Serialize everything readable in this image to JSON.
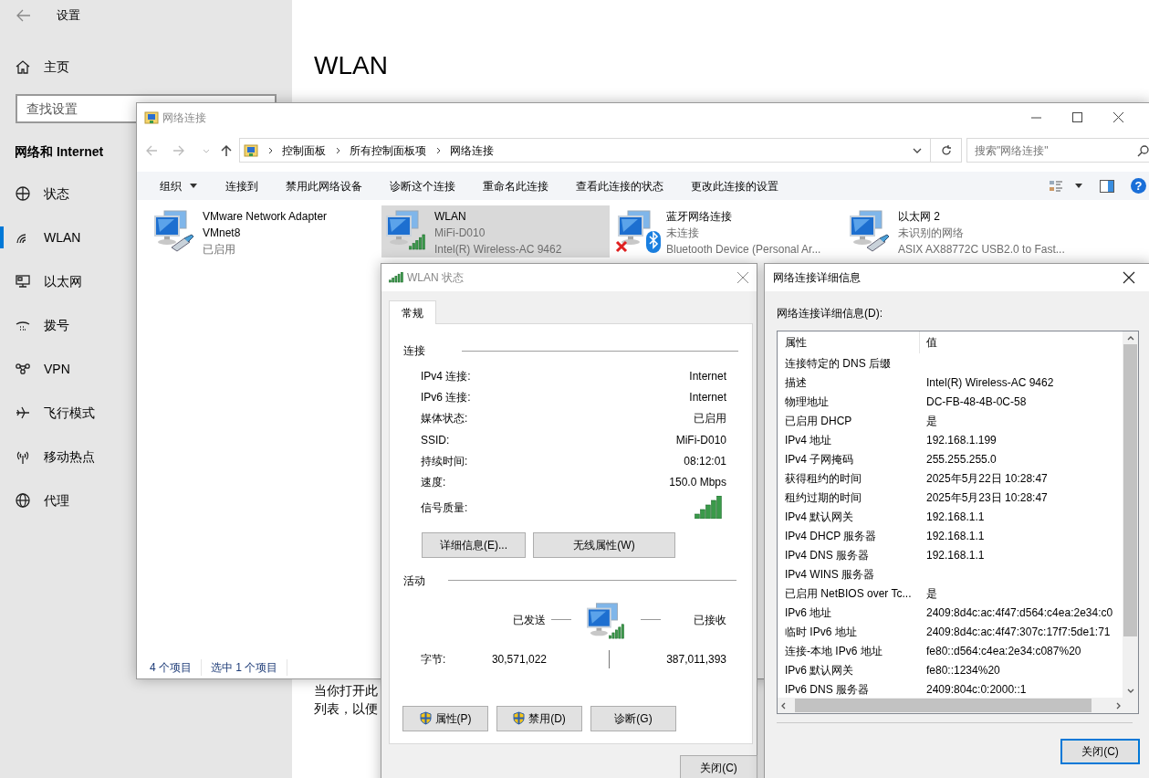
{
  "settings": {
    "title": "设置",
    "home": "主页",
    "search": {
      "placeholder": "查找设置"
    },
    "section": "网络和 Internet",
    "nav": [
      {
        "label": "状态",
        "kind": "status",
        "selected": false
      },
      {
        "label": "WLAN",
        "kind": "wifi",
        "selected": true
      },
      {
        "label": "以太网",
        "kind": "ethernet",
        "selected": false
      },
      {
        "label": "拨号",
        "kind": "dialup",
        "selected": false
      },
      {
        "label": "VPN",
        "kind": "vpn",
        "selected": false
      },
      {
        "label": "飞行模式",
        "kind": "airplane",
        "selected": false
      },
      {
        "label": "移动热点",
        "kind": "hotspot",
        "selected": false
      },
      {
        "label": "代理",
        "kind": "proxy",
        "selected": false
      }
    ],
    "page_title": "WLAN",
    "body_lines": [
      "当你打开此",
      "列表，以便"
    ]
  },
  "explorer": {
    "title": "网络连接",
    "breadcrumb": [
      "控制面板",
      "所有控制面板项",
      "网络连接"
    ],
    "search": {
      "placeholder": "搜索\"网络连接\""
    },
    "toolbar": [
      {
        "label": "组织",
        "menu": true
      },
      {
        "label": "连接到",
        "menu": false
      },
      {
        "label": "禁用此网络设备",
        "menu": false
      },
      {
        "label": "诊断这个连接",
        "menu": false
      },
      {
        "label": "重命名此连接",
        "menu": false
      },
      {
        "label": "查看此连接的状态",
        "menu": false
      },
      {
        "label": "更改此连接的设置",
        "menu": false
      }
    ],
    "help": "?",
    "adapters": [
      {
        "name": "VMware Network Adapter VMnet8",
        "status": "已启用",
        "kind": "wired",
        "error": false,
        "selected": false
      },
      {
        "name": "WLAN",
        "status": "MiFi-D010",
        "device": "Intel(R) Wireless-AC 9462",
        "kind": "wifi",
        "error": false,
        "selected": true
      },
      {
        "name": "蓝牙网络连接",
        "status": "未连接",
        "device": "Bluetooth Device (Personal Ar...",
        "kind": "bluetooth",
        "error": true,
        "selected": false
      },
      {
        "name": "以太网 2",
        "status": "未识别的网络",
        "device": "ASIX AX88772C USB2.0 to Fast...",
        "kind": "wired",
        "error": false,
        "selected": false
      }
    ],
    "status_bar": [
      "4 个项目",
      "选中 1 个项目"
    ]
  },
  "wlan_status": {
    "title": "WLAN 状态",
    "tabs": [
      {
        "label": "常规",
        "selected": true
      }
    ],
    "connection": {
      "heading": "连接",
      "rows": [
        {
          "label": "IPv4 连接:",
          "value": "Internet"
        },
        {
          "label": "IPv6 连接:",
          "value": "Internet"
        },
        {
          "label": "媒体状态:",
          "value": "已启用"
        },
        {
          "label": "SSID:",
          "value": "MiFi-D010"
        },
        {
          "label": "持续时间:",
          "value": "08:12:01"
        },
        {
          "label": "速度:",
          "value": "150.0 Mbps"
        }
      ],
      "signal_label": "信号质量:",
      "buttons": [
        "详细信息(E)...",
        "无线属性(W)"
      ]
    },
    "activity": {
      "heading": "活动",
      "sent": "已发送",
      "received": "已接收",
      "bytes_label": "字节:",
      "bytes_sent": "30,571,022",
      "bytes_received": "387,011,393"
    },
    "buttons": [
      {
        "label": "属性(P)",
        "shield": true
      },
      {
        "label": "禁用(D)",
        "shield": true
      },
      {
        "label": "诊断(G)",
        "shield": false
      }
    ],
    "close": {
      "label": "关闭(C)",
      "default": false
    }
  },
  "details": {
    "title": "网络连接详细信息",
    "list_label": "网络连接详细信息(D):",
    "columns": [
      "属性",
      "值"
    ],
    "rows": [
      {
        "property": "连接特定的 DNS 后缀"
      },
      {
        "property": "描述",
        "value": "Intel(R) Wireless-AC 9462"
      },
      {
        "property": "物理地址",
        "value": "DC-FB-48-4B-0C-58"
      },
      {
        "property": "已启用 DHCP",
        "value": "是"
      },
      {
        "property": "IPv4 地址",
        "value": "192.168.1.199"
      },
      {
        "property": "IPv4 子网掩码",
        "value": "255.255.255.0"
      },
      {
        "property": "获得租约的时间",
        "value": "2025年5月22日 10:28:47"
      },
      {
        "property": "租约过期的时间",
        "value": "2025年5月23日 10:28:47"
      },
      {
        "property": "IPv4 默认网关",
        "value": "192.168.1.1"
      },
      {
        "property": "IPv4 DHCP 服务器",
        "value": "192.168.1.1"
      },
      {
        "property": "IPv4 DNS 服务器",
        "value": "192.168.1.1"
      },
      {
        "property": "IPv4 WINS 服务器"
      },
      {
        "property": "已启用 NetBIOS over Tc...",
        "value": "是"
      },
      {
        "property": "IPv6 地址",
        "value": "2409:8d4c:ac:4f47:d564:c4ea:2e34:c0"
      },
      {
        "property": "临时 IPv6 地址",
        "value": "2409:8d4c:ac:4f47:307c:17f7:5de1:71"
      },
      {
        "property": "连接-本地 IPv6 地址",
        "value": "fe80::d564:c4ea:2e34:c087%20"
      },
      {
        "property": "IPv6 默认网关",
        "value": "fe80::1234%20"
      },
      {
        "property": "IPv6 DNS 服务器",
        "value": "2409:804c:0:2000::1"
      }
    ],
    "close": {
      "label": "关闭(C)",
      "default": true
    }
  }
}
